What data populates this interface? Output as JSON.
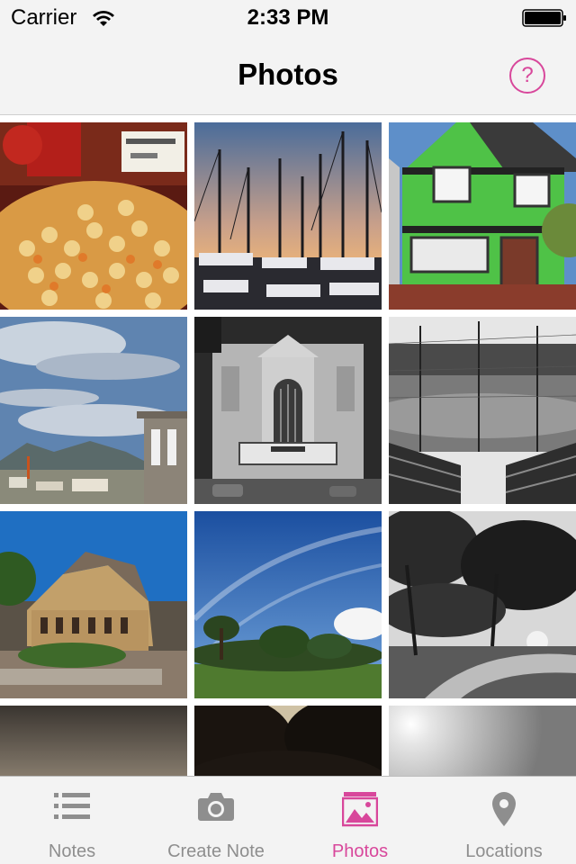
{
  "status": {
    "carrier": "Carrier",
    "time": "2:33 PM"
  },
  "nav": {
    "title": "Photos",
    "help_glyph": "?",
    "accent": "#d8479b"
  },
  "photos": [
    {
      "subject": "candy-market"
    },
    {
      "subject": "marina-sailboats"
    },
    {
      "subject": "green-house"
    },
    {
      "subject": "bay-view"
    },
    {
      "subject": "castro-theatre"
    },
    {
      "subject": "baseball-field"
    },
    {
      "subject": "stone-building"
    },
    {
      "subject": "park-cypress"
    },
    {
      "subject": "bw-trees"
    },
    {
      "subject": "sunset-sky"
    },
    {
      "subject": "tree-silhouette"
    },
    {
      "subject": "sun-glare"
    }
  ],
  "tabs": [
    {
      "label": "Notes",
      "icon": "list-icon",
      "active": false
    },
    {
      "label": "Create Note",
      "icon": "camera-icon",
      "active": false
    },
    {
      "label": "Photos",
      "icon": "photos-icon",
      "active": true
    },
    {
      "label": "Locations",
      "icon": "location-pin-icon",
      "active": false
    }
  ],
  "colors": {
    "accent": "#d8479b",
    "inactive": "#8e8e8e",
    "bar": "#f3f3f3"
  }
}
